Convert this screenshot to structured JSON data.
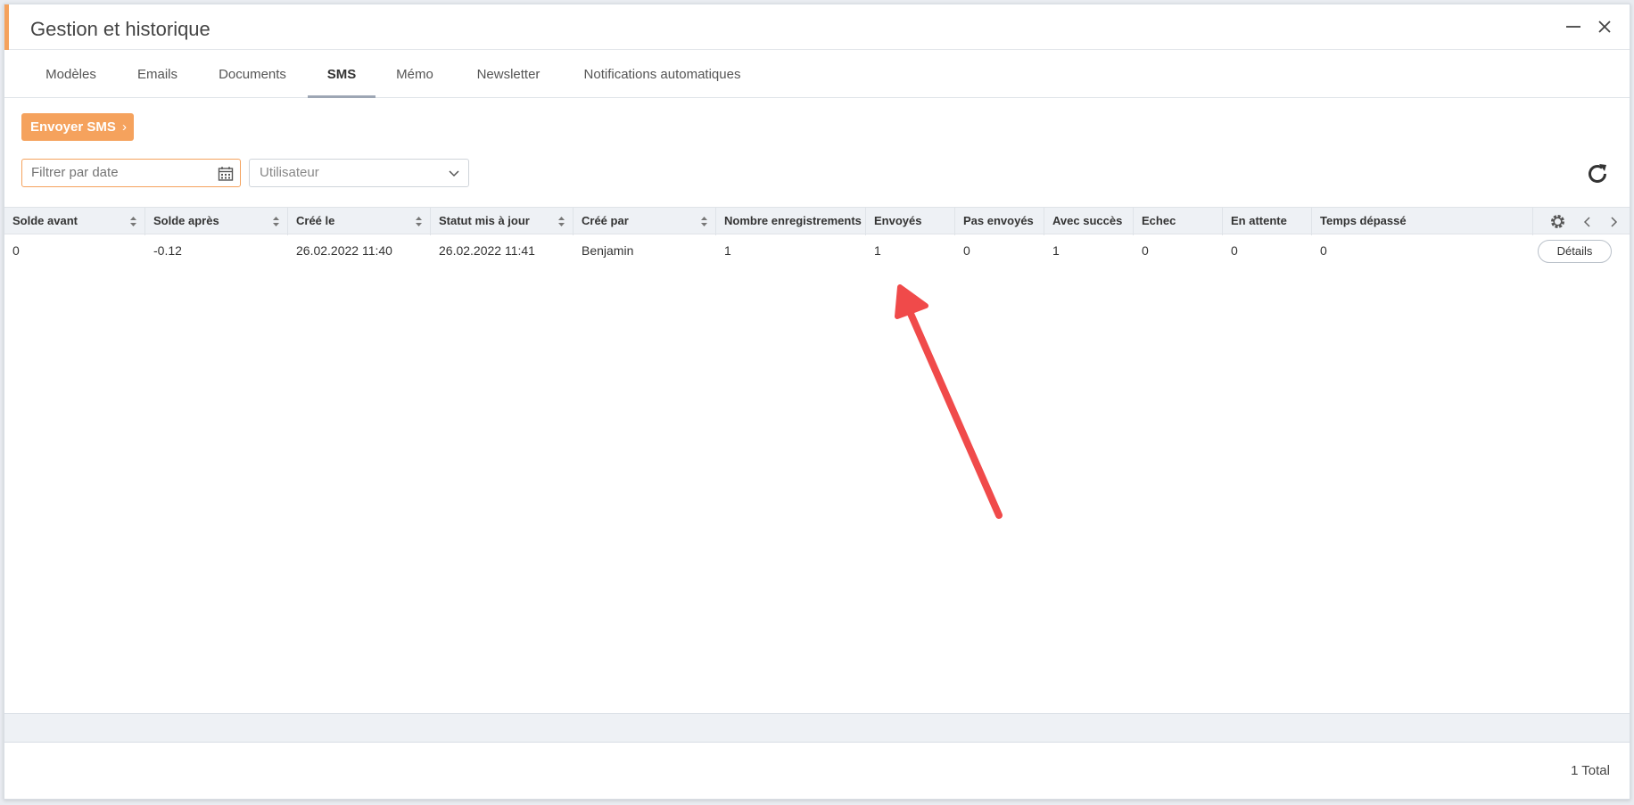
{
  "window": {
    "title": "Gestion et historique"
  },
  "tabs": [
    {
      "label": "Modèles"
    },
    {
      "label": "Emails"
    },
    {
      "label": "Documents"
    },
    {
      "label": "SMS",
      "active": true
    },
    {
      "label": "Mémo"
    },
    {
      "label": "Newsletter"
    },
    {
      "label": "Notifications automatiques"
    }
  ],
  "actions": {
    "send_sms_label": "Envoyer SMS"
  },
  "filters": {
    "date_placeholder": "Filtrer par date",
    "user_select_value": "Utilisateur"
  },
  "table": {
    "columns": [
      "Solde avant",
      "Solde après",
      "Créé le",
      "Statut mis à jour",
      "Créé par",
      "Nombre enregistrements",
      "Envoyés",
      "Pas envoyés",
      "Avec succès",
      "Echec",
      "En attente",
      "Temps dépassé"
    ],
    "rows": [
      {
        "cells": [
          "0",
          "-0.12",
          "26.02.2022 11:40",
          "26.02.2022 11:41",
          "Benjamin",
          "1",
          "1",
          "0",
          "1",
          "0",
          "0",
          "0"
        ],
        "details_label": "Détails"
      }
    ]
  },
  "footer": {
    "total_label": "1 Total"
  },
  "colors": {
    "accent": "#f5a25d",
    "annotation_arrow": "#f04a4a"
  }
}
